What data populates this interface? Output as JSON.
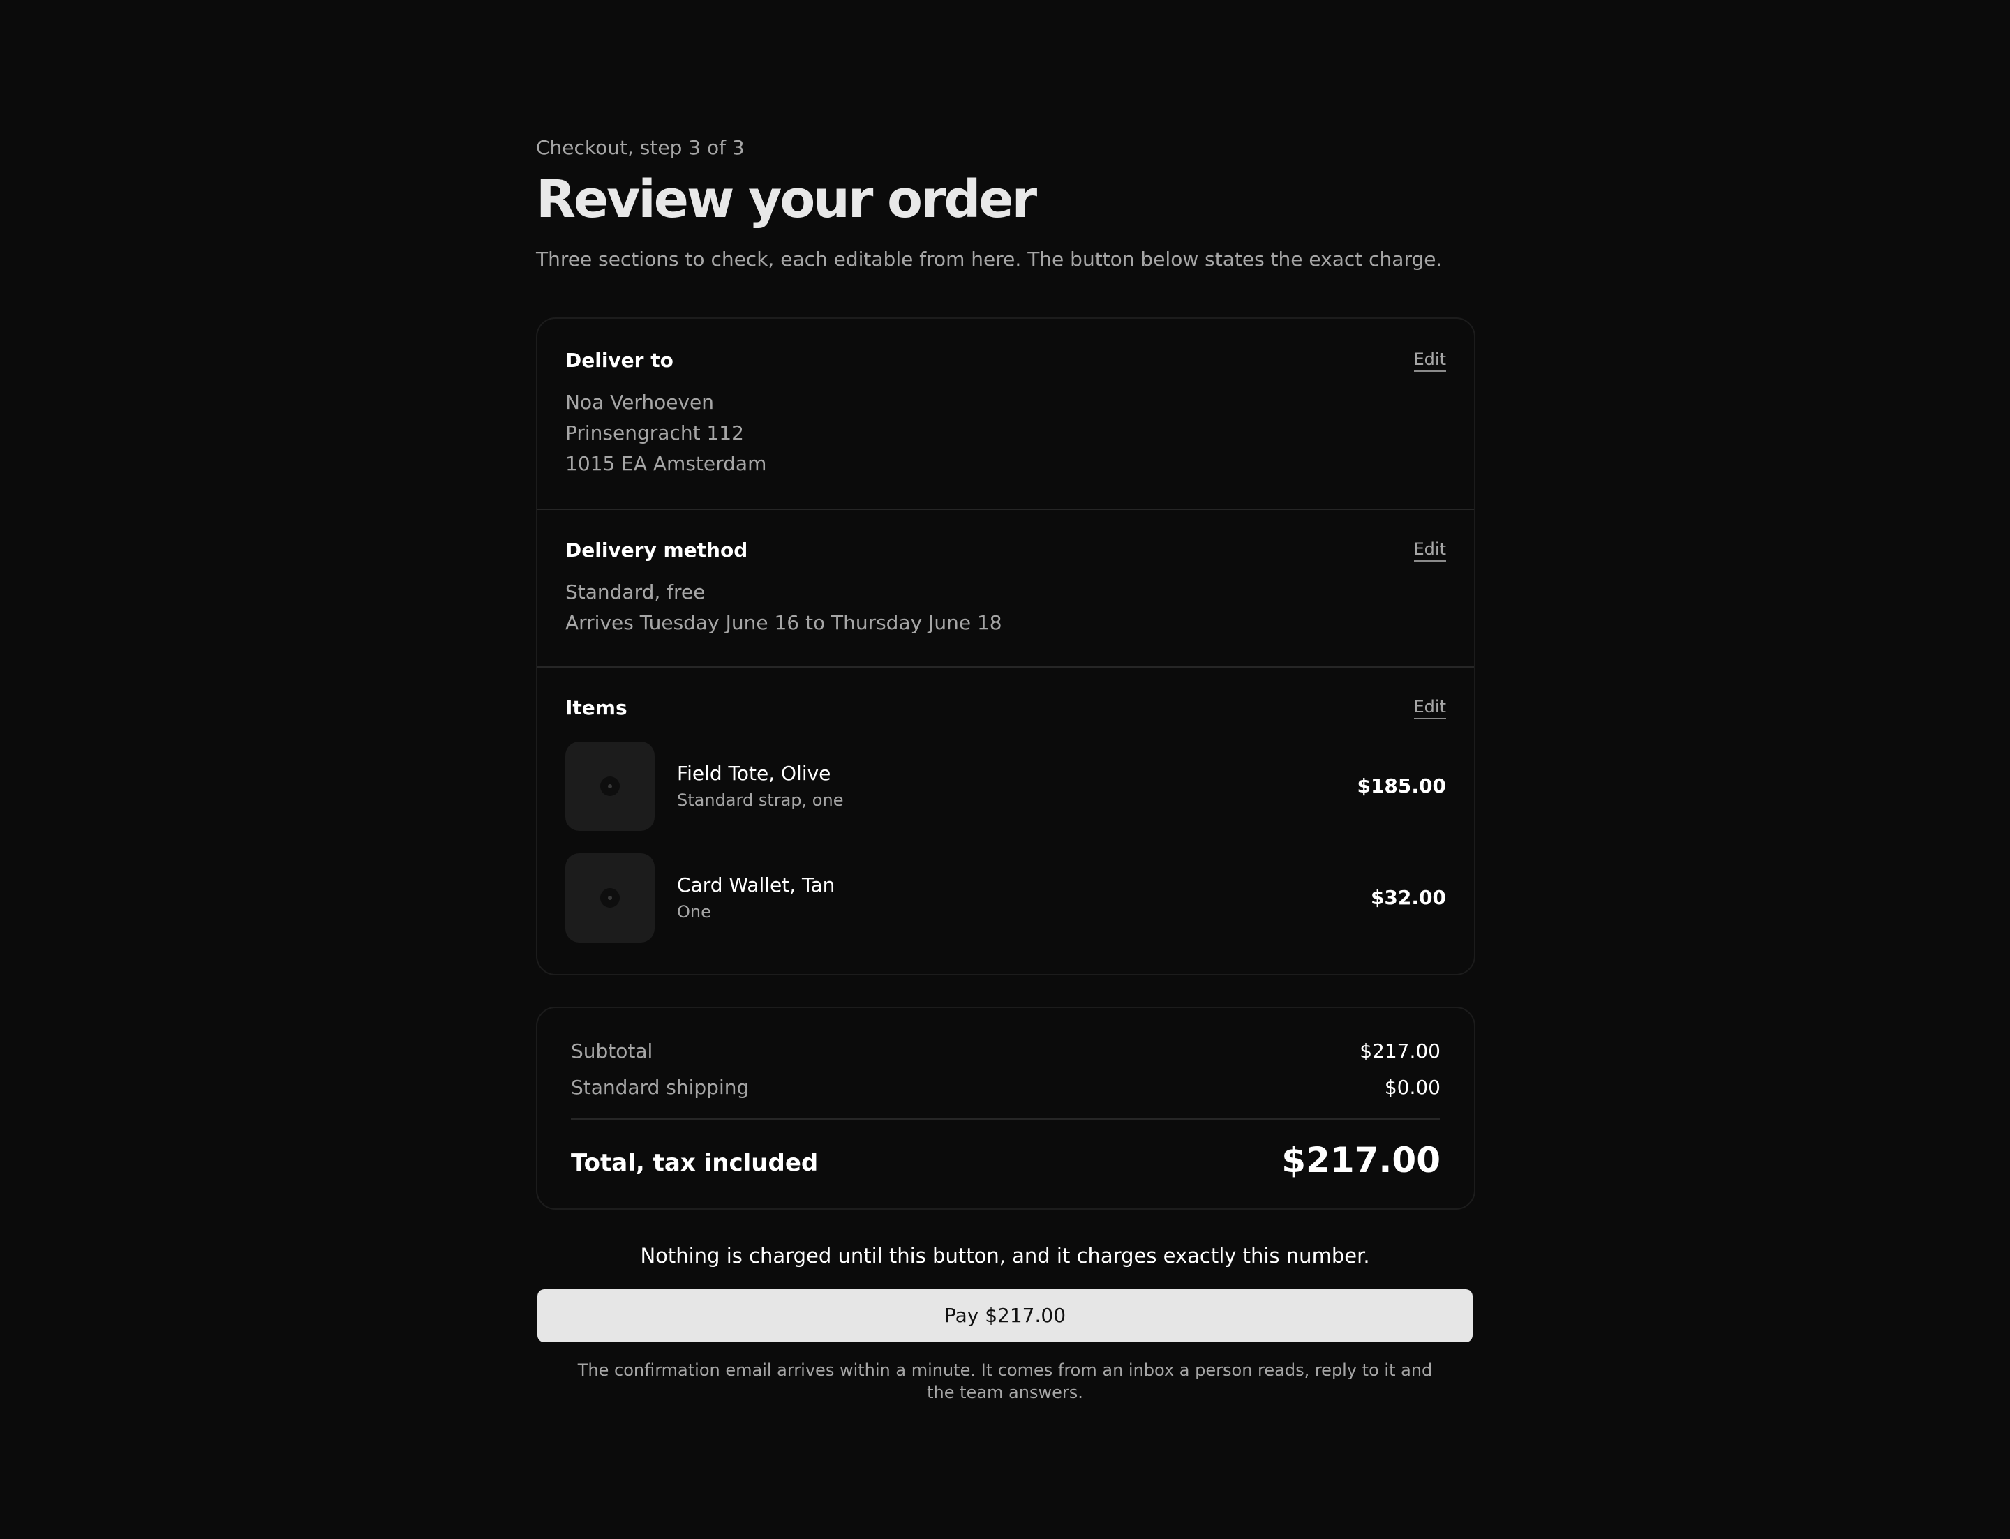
{
  "header": {
    "eyebrow": "Checkout, step 3 of 3",
    "title": "Review your order",
    "subtitle": "Three sections to check, each editable from here. The button below states the exact charge."
  },
  "sections": {
    "ship": {
      "title": "Deliver to",
      "edit_label": "Edit",
      "lines": [
        "Noa Verhoeven",
        "Prinsengracht 112",
        "1015 EA Amsterdam"
      ]
    },
    "method": {
      "title": "Delivery method",
      "edit_label": "Edit",
      "lines": [
        "Standard, free",
        "Arrives Tuesday June 16 to Thursday June 18"
      ]
    },
    "items": {
      "title": "Items",
      "edit_label": "Edit",
      "list": [
        {
          "name": "Field Tote, Olive",
          "variant": "Standard strap, one",
          "price": "$185.00",
          "thumb_icon": "product-placeholder-icon"
        },
        {
          "name": "Card Wallet, Tan",
          "variant": "One",
          "price": "$32.00",
          "thumb_icon": "product-placeholder-icon"
        }
      ]
    }
  },
  "summary": {
    "subtotal_label": "Subtotal",
    "subtotal_value": "$217.00",
    "shipping_label": "Standard shipping",
    "shipping_value": "$0.00",
    "total_label": "Total, tax included",
    "total_value": "$217.00"
  },
  "notice": "Nothing is charged until this button, and it charges exactly this number.",
  "pay_button_label": "Pay $217.00",
  "footnote": "The confirmation email arrives within a minute. It comes from an inbox a person reads, reply to it and the team answers.",
  "colors": {
    "background": "#0b0b0b",
    "card_border": "#1c1c1c",
    "divider": "#262626",
    "muted_text": "#a6a6a6",
    "primary_text": "#ffffff",
    "button_bg": "#e6e6e6",
    "button_text": "#111111",
    "thumb_bg": "#1c1c1c"
  }
}
